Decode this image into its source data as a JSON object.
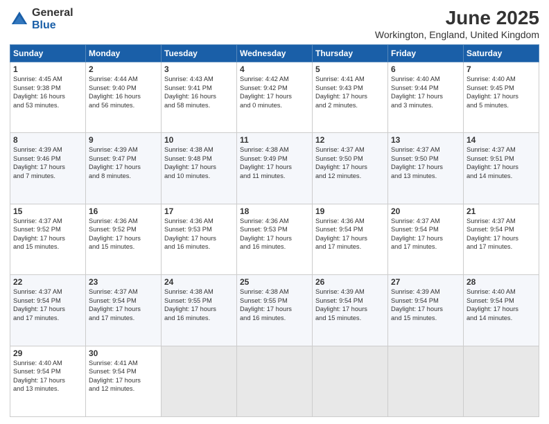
{
  "header": {
    "logo_general": "General",
    "logo_blue": "Blue",
    "month_title": "June 2025",
    "location": "Workington, England, United Kingdom"
  },
  "weekdays": [
    "Sunday",
    "Monday",
    "Tuesday",
    "Wednesday",
    "Thursday",
    "Friday",
    "Saturday"
  ],
  "rows": [
    [
      {
        "day": "1",
        "info": "Sunrise: 4:45 AM\nSunset: 9:38 PM\nDaylight: 16 hours\nand 53 minutes."
      },
      {
        "day": "2",
        "info": "Sunrise: 4:44 AM\nSunset: 9:40 PM\nDaylight: 16 hours\nand 56 minutes."
      },
      {
        "day": "3",
        "info": "Sunrise: 4:43 AM\nSunset: 9:41 PM\nDaylight: 16 hours\nand 58 minutes."
      },
      {
        "day": "4",
        "info": "Sunrise: 4:42 AM\nSunset: 9:42 PM\nDaylight: 17 hours\nand 0 minutes."
      },
      {
        "day": "5",
        "info": "Sunrise: 4:41 AM\nSunset: 9:43 PM\nDaylight: 17 hours\nand 2 minutes."
      },
      {
        "day": "6",
        "info": "Sunrise: 4:40 AM\nSunset: 9:44 PM\nDaylight: 17 hours\nand 3 minutes."
      },
      {
        "day": "7",
        "info": "Sunrise: 4:40 AM\nSunset: 9:45 PM\nDaylight: 17 hours\nand 5 minutes."
      }
    ],
    [
      {
        "day": "8",
        "info": "Sunrise: 4:39 AM\nSunset: 9:46 PM\nDaylight: 17 hours\nand 7 minutes."
      },
      {
        "day": "9",
        "info": "Sunrise: 4:39 AM\nSunset: 9:47 PM\nDaylight: 17 hours\nand 8 minutes."
      },
      {
        "day": "10",
        "info": "Sunrise: 4:38 AM\nSunset: 9:48 PM\nDaylight: 17 hours\nand 10 minutes."
      },
      {
        "day": "11",
        "info": "Sunrise: 4:38 AM\nSunset: 9:49 PM\nDaylight: 17 hours\nand 11 minutes."
      },
      {
        "day": "12",
        "info": "Sunrise: 4:37 AM\nSunset: 9:50 PM\nDaylight: 17 hours\nand 12 minutes."
      },
      {
        "day": "13",
        "info": "Sunrise: 4:37 AM\nSunset: 9:50 PM\nDaylight: 17 hours\nand 13 minutes."
      },
      {
        "day": "14",
        "info": "Sunrise: 4:37 AM\nSunset: 9:51 PM\nDaylight: 17 hours\nand 14 minutes."
      }
    ],
    [
      {
        "day": "15",
        "info": "Sunrise: 4:37 AM\nSunset: 9:52 PM\nDaylight: 17 hours\nand 15 minutes."
      },
      {
        "day": "16",
        "info": "Sunrise: 4:36 AM\nSunset: 9:52 PM\nDaylight: 17 hours\nand 15 minutes."
      },
      {
        "day": "17",
        "info": "Sunrise: 4:36 AM\nSunset: 9:53 PM\nDaylight: 17 hours\nand 16 minutes."
      },
      {
        "day": "18",
        "info": "Sunrise: 4:36 AM\nSunset: 9:53 PM\nDaylight: 17 hours\nand 16 minutes."
      },
      {
        "day": "19",
        "info": "Sunrise: 4:36 AM\nSunset: 9:54 PM\nDaylight: 17 hours\nand 17 minutes."
      },
      {
        "day": "20",
        "info": "Sunrise: 4:37 AM\nSunset: 9:54 PM\nDaylight: 17 hours\nand 17 minutes."
      },
      {
        "day": "21",
        "info": "Sunrise: 4:37 AM\nSunset: 9:54 PM\nDaylight: 17 hours\nand 17 minutes."
      }
    ],
    [
      {
        "day": "22",
        "info": "Sunrise: 4:37 AM\nSunset: 9:54 PM\nDaylight: 17 hours\nand 17 minutes."
      },
      {
        "day": "23",
        "info": "Sunrise: 4:37 AM\nSunset: 9:54 PM\nDaylight: 17 hours\nand 17 minutes."
      },
      {
        "day": "24",
        "info": "Sunrise: 4:38 AM\nSunset: 9:55 PM\nDaylight: 17 hours\nand 16 minutes."
      },
      {
        "day": "25",
        "info": "Sunrise: 4:38 AM\nSunset: 9:55 PM\nDaylight: 17 hours\nand 16 minutes."
      },
      {
        "day": "26",
        "info": "Sunrise: 4:39 AM\nSunset: 9:54 PM\nDaylight: 17 hours\nand 15 minutes."
      },
      {
        "day": "27",
        "info": "Sunrise: 4:39 AM\nSunset: 9:54 PM\nDaylight: 17 hours\nand 15 minutes."
      },
      {
        "day": "28",
        "info": "Sunrise: 4:40 AM\nSunset: 9:54 PM\nDaylight: 17 hours\nand 14 minutes."
      }
    ],
    [
      {
        "day": "29",
        "info": "Sunrise: 4:40 AM\nSunset: 9:54 PM\nDaylight: 17 hours\nand 13 minutes."
      },
      {
        "day": "30",
        "info": "Sunrise: 4:41 AM\nSunset: 9:54 PM\nDaylight: 17 hours\nand 12 minutes."
      },
      null,
      null,
      null,
      null,
      null
    ]
  ]
}
